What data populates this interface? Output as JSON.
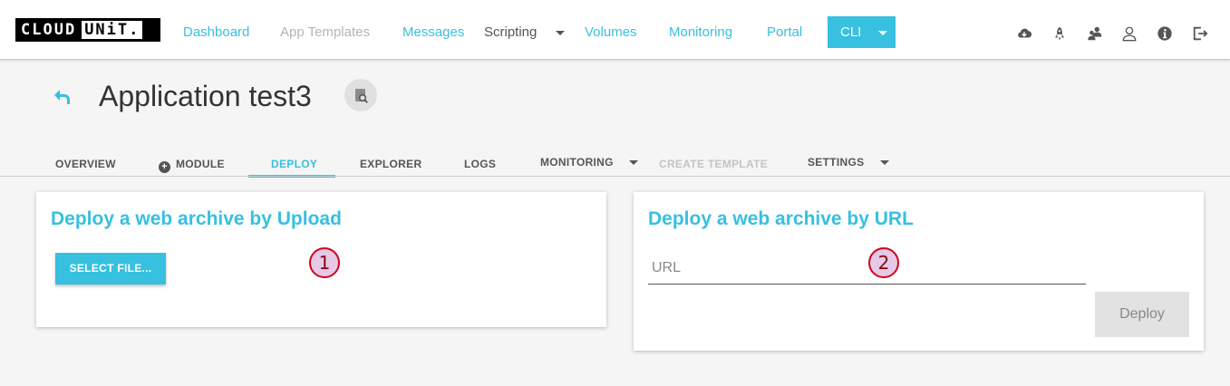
{
  "app": {
    "logo_left": "CLOUD",
    "logo_right": "UNiT."
  },
  "nav": {
    "dashboard": "Dashboard",
    "app_templates": "App Templates",
    "messages": "Messages",
    "scripting": "Scripting",
    "volumes": "Volumes",
    "monitoring": "Monitoring",
    "portal": "Portal",
    "cli": "CLI"
  },
  "header": {
    "title": "Application test3"
  },
  "tabs": {
    "overview": "OVERVIEW",
    "module": "MODULE",
    "deploy": "DEPLOY",
    "explorer": "EXPLORER",
    "logs": "LOGS",
    "monitoring": "MONITORING",
    "create_template": "CREATE TEMPLATE",
    "settings": "SETTINGS"
  },
  "upload_card": {
    "title": "Deploy a web archive by Upload",
    "select_label": "SELECT FILE...",
    "marker": "1"
  },
  "url_card": {
    "title": "Deploy a web archive by URL",
    "url_placeholder": "URL",
    "deploy_label": "Deploy",
    "marker": "2"
  },
  "colors": {
    "accent": "#37c0e0",
    "marker_border": "#d0021b"
  }
}
